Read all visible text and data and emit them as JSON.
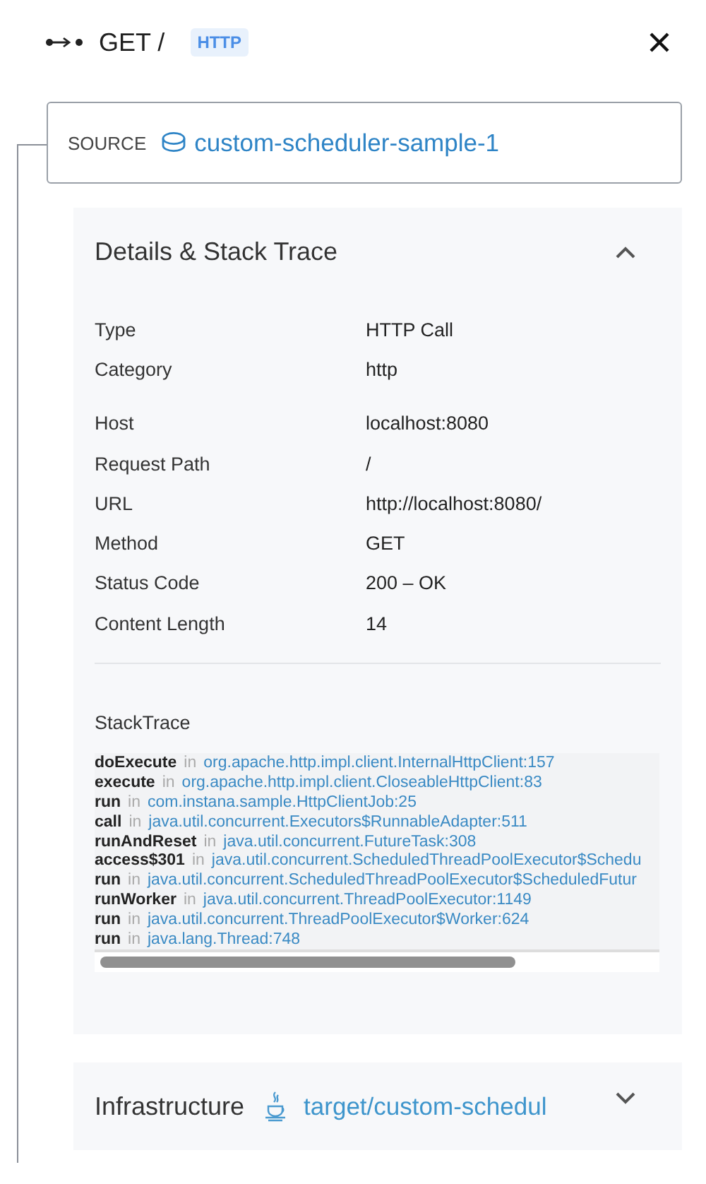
{
  "header": {
    "title": "GET /",
    "badge": "HTTP"
  },
  "source": {
    "label": "SOURCE",
    "name": "custom-scheduler-sample-1"
  },
  "details": {
    "title": "Details & Stack Trace",
    "expanded": true,
    "groups": [
      [
        {
          "label": "Type",
          "value": "HTTP Call"
        },
        {
          "label": "Category",
          "value": "http"
        }
      ],
      [
        {
          "label": "Host",
          "value": "localhost:8080"
        },
        {
          "label": "Request Path",
          "value": "/"
        },
        {
          "label": "URL",
          "value": "http://localhost:8080/"
        },
        {
          "label": "Method",
          "value": "GET"
        },
        {
          "label": "Status Code",
          "value": "200 – OK"
        },
        {
          "label": "Content Length",
          "value": "14"
        }
      ]
    ],
    "stack_title": "StackTrace",
    "stack": [
      {
        "method": "doExecute",
        "in": "in",
        "location": "org.apache.http.impl.client.InternalHttpClient:157"
      },
      {
        "method": "execute",
        "in": "in",
        "location": "org.apache.http.impl.client.CloseableHttpClient:83"
      },
      {
        "method": "run",
        "in": "in",
        "location": "com.instana.sample.HttpClientJob:25"
      },
      {
        "method": "call",
        "in": "in",
        "location": "java.util.concurrent.Executors$RunnableAdapter:511"
      },
      {
        "method": "runAndReset",
        "in": "in",
        "location": "java.util.concurrent.FutureTask:308"
      },
      {
        "method": "access$301",
        "in": "in",
        "location": "java.util.concurrent.ScheduledThreadPoolExecutor$Schedu"
      },
      {
        "method": "run",
        "in": "in",
        "location": "java.util.concurrent.ScheduledThreadPoolExecutor$ScheduledFutur"
      },
      {
        "method": "runWorker",
        "in": "in",
        "location": "java.util.concurrent.ThreadPoolExecutor:1149"
      },
      {
        "method": "run",
        "in": "in",
        "location": "java.util.concurrent.ThreadPoolExecutor$Worker:624"
      },
      {
        "method": "run",
        "in": "in",
        "location": "java.lang.Thread:748"
      }
    ]
  },
  "infrastructure": {
    "title": "Infrastructure",
    "target": "target/custom-schedul",
    "expanded": false
  }
}
